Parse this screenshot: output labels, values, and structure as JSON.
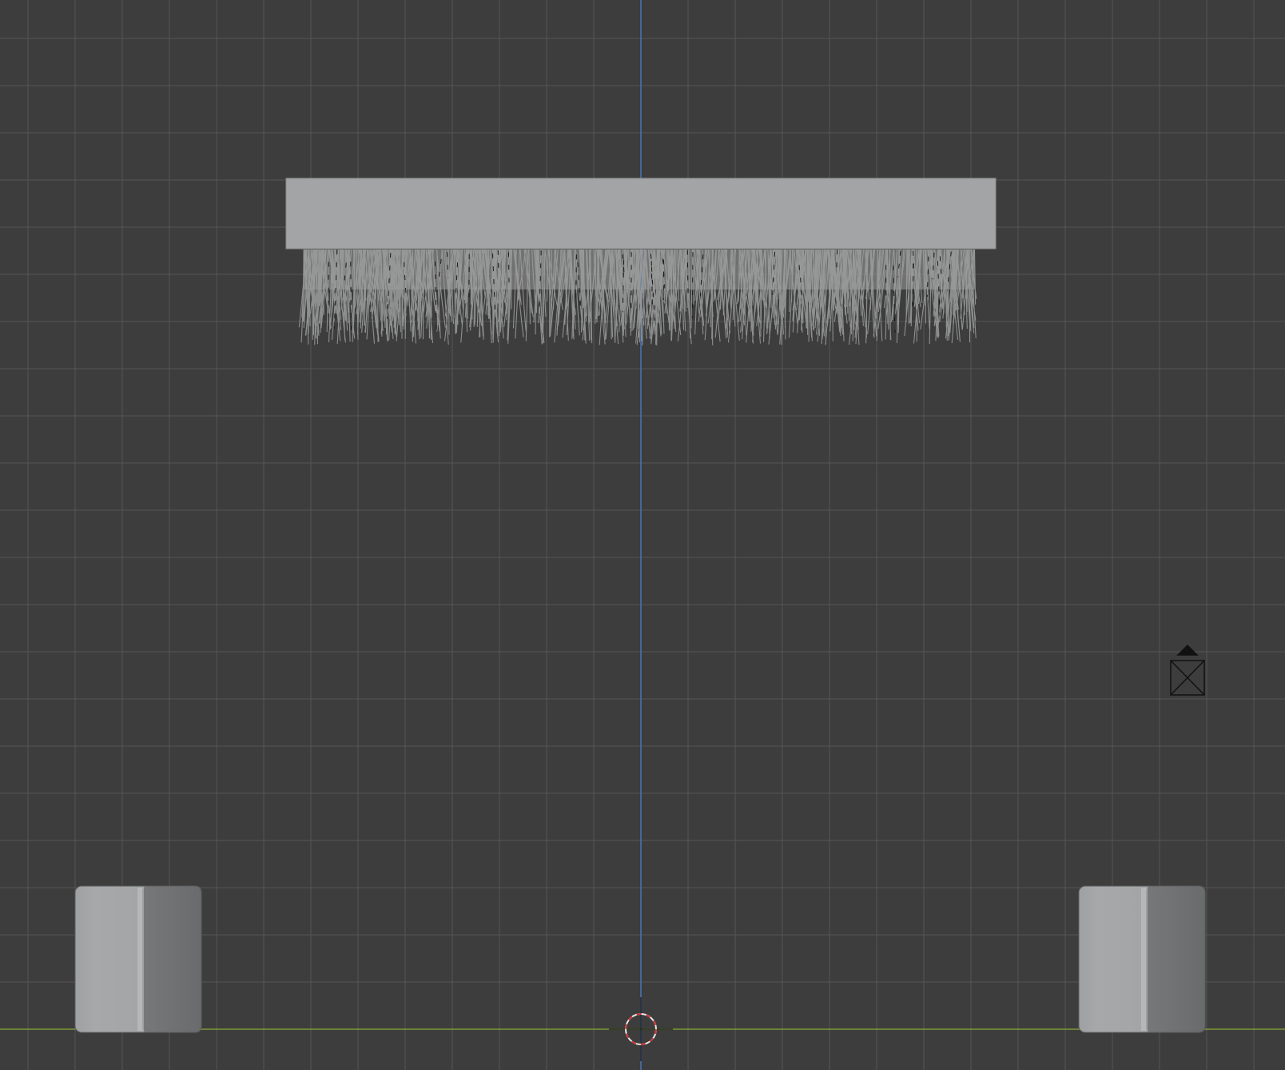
{
  "viewport": {
    "view": "front-orthographic",
    "grid_visible": true,
    "colors": {
      "background": "#3d3d3d",
      "grid_line": "#555555",
      "z_axis": "#4a74b6",
      "x_axis": "#7d9a36",
      "mesh_light": "#a3a4a5",
      "mesh_dark": "#6a6b6c",
      "hair": "#9c9d9e",
      "cursor_red": "#d0383a",
      "cursor_white": "#e8e8e8"
    },
    "icons": {
      "camera": "camera-icon",
      "cursor": "3d-cursor-icon"
    }
  }
}
